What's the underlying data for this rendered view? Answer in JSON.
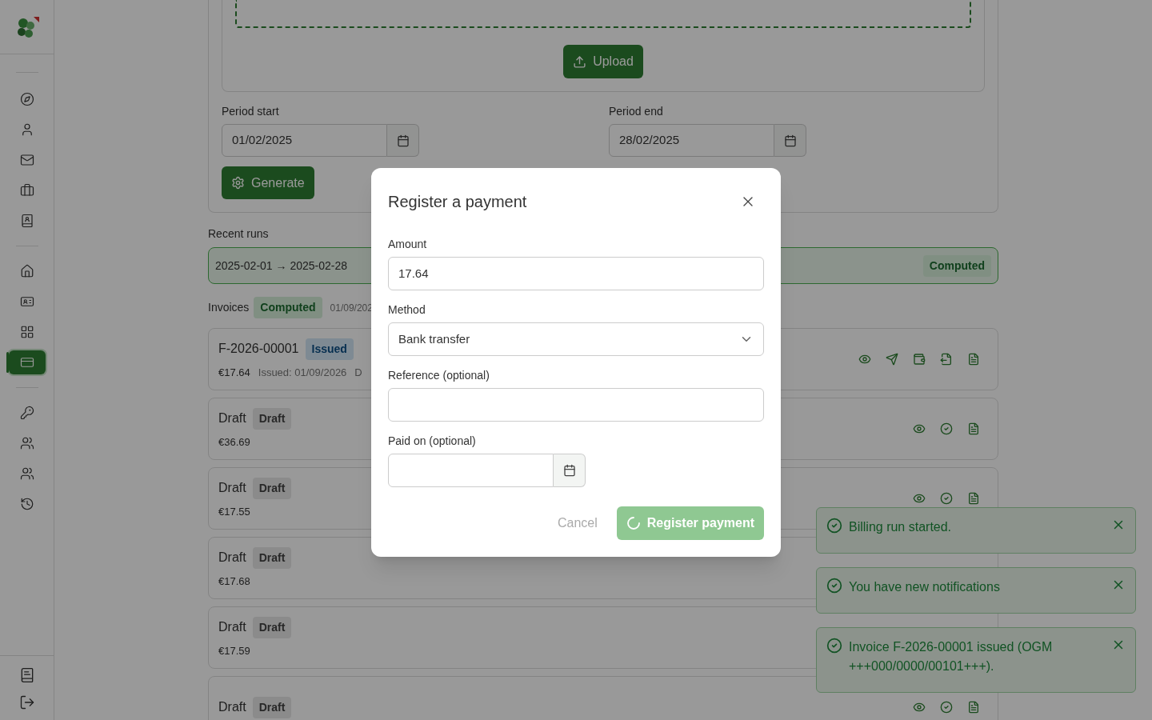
{
  "sidebar": {
    "groups": [
      [
        {
          "selected": false
        },
        {
          "selected": false
        },
        {
          "selected": false
        },
        {
          "selected": false
        },
        {
          "selected": false
        }
      ],
      [
        {
          "selected": false
        },
        {
          "selected": false
        },
        {
          "selected": false
        },
        {
          "selected": true
        }
      ],
      [
        {
          "selected": false
        },
        {
          "selected": false
        },
        {
          "selected": false
        },
        {
          "selected": false
        }
      ]
    ]
  },
  "upload_button": "Upload",
  "period_start": {
    "label": "Period start",
    "value": "01/02/2025"
  },
  "period_end": {
    "label": "Period end",
    "value": "28/02/2025"
  },
  "generate_button": "Generate",
  "recent_runs": {
    "heading": "Recent runs",
    "runs": [
      {
        "range": "2025-02-01 → 2025-02-28",
        "status": "Computed",
        "kind": "computed"
      }
    ]
  },
  "invoices": {
    "heading": "Invoices",
    "status": "Computed",
    "kind": "computed",
    "date": "01/09/202",
    "items": [
      {
        "title": "F-2026-00001",
        "status": "Issued",
        "kind": "issued",
        "amount": "€17.64",
        "issued": "Issued: 01/09/2026",
        "extra": "D",
        "actions": [
          {
            "kind": "view"
          },
          {
            "kind": "send"
          },
          {
            "kind": "pay"
          },
          {
            "kind": "export"
          },
          {
            "kind": "pdf"
          }
        ]
      },
      {
        "title": "Draft",
        "status": "Draft",
        "kind": "draft",
        "amount": "€36.69",
        "actions": [
          {
            "kind": "view"
          },
          {
            "kind": "validate"
          },
          {
            "kind": "pdf"
          }
        ]
      },
      {
        "title": "Draft",
        "status": "Draft",
        "kind": "draft",
        "amount": "€17.55",
        "actions": [
          {
            "kind": "view"
          },
          {
            "kind": "validate"
          },
          {
            "kind": "pdf"
          }
        ]
      },
      {
        "title": "Draft",
        "status": "Draft",
        "kind": "draft",
        "amount": "€17.68"
      },
      {
        "title": "Draft",
        "status": "Draft",
        "kind": "draft",
        "amount": "€17.59"
      },
      {
        "title": "Draft",
        "status": "Draft",
        "kind": "draft",
        "actions": [
          {
            "kind": "view"
          },
          {
            "kind": "validate"
          },
          {
            "kind": "pdf"
          }
        ]
      }
    ]
  },
  "dialog": {
    "title": "Register a payment",
    "fields": [
      {
        "kind": "text",
        "label": "Amount",
        "value": "17.64"
      },
      {
        "kind": "select",
        "label": "Method",
        "value": "Bank transfer"
      },
      {
        "kind": "text",
        "label": "Reference (optional)"
      },
      {
        "kind": "date",
        "label": "Paid on (optional)"
      }
    ],
    "cancel": {
      "label": "Cancel",
      "disabled": true
    },
    "submit": {
      "label": "Register payment",
      "loading": true
    }
  },
  "toasts": [
    {
      "text": "Billing run started."
    },
    {
      "text": "You have new notifications"
    },
    {
      "text": "Invoice F-2026-00001 issued (OGM +++000/0000/00101+++)."
    }
  ]
}
